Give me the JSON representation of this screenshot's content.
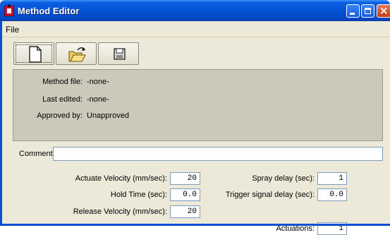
{
  "window": {
    "title": "Method Editor"
  },
  "menu": {
    "file_label": "File"
  },
  "toolbar": {
    "new_icon": "new-document-icon",
    "open_icon": "open-folder-icon",
    "save_icon": "floppy-disk-icon"
  },
  "info": {
    "method_file_label": "Method file:",
    "method_file_value": "-none-",
    "last_edited_label": "Last edited:",
    "last_edited_value": "-none-",
    "approved_by_label": "Approved by:",
    "approved_by_value": "Unapproved"
  },
  "comment": {
    "label": "Comment:",
    "value": ""
  },
  "params": {
    "actuate_velocity_label": "Actuate Velocity (mm/sec):",
    "actuate_velocity_value": "20",
    "hold_time_label": "Hold Time (sec):",
    "hold_time_value": "0.0",
    "release_velocity_label": "Release Velocity (mm/sec):",
    "release_velocity_value": "20",
    "spray_delay_label": "Spray delay (sec):",
    "spray_delay_value": "1",
    "trigger_delay_label": "Trigger signal delay (sec):",
    "trigger_delay_value": "0.0",
    "actuations_label": "Actuations:",
    "actuations_value": "1"
  },
  "colors": {
    "titlebar": "#0553d6",
    "window_bg": "#ece9d8",
    "info_bg": "#ccc9bb"
  }
}
